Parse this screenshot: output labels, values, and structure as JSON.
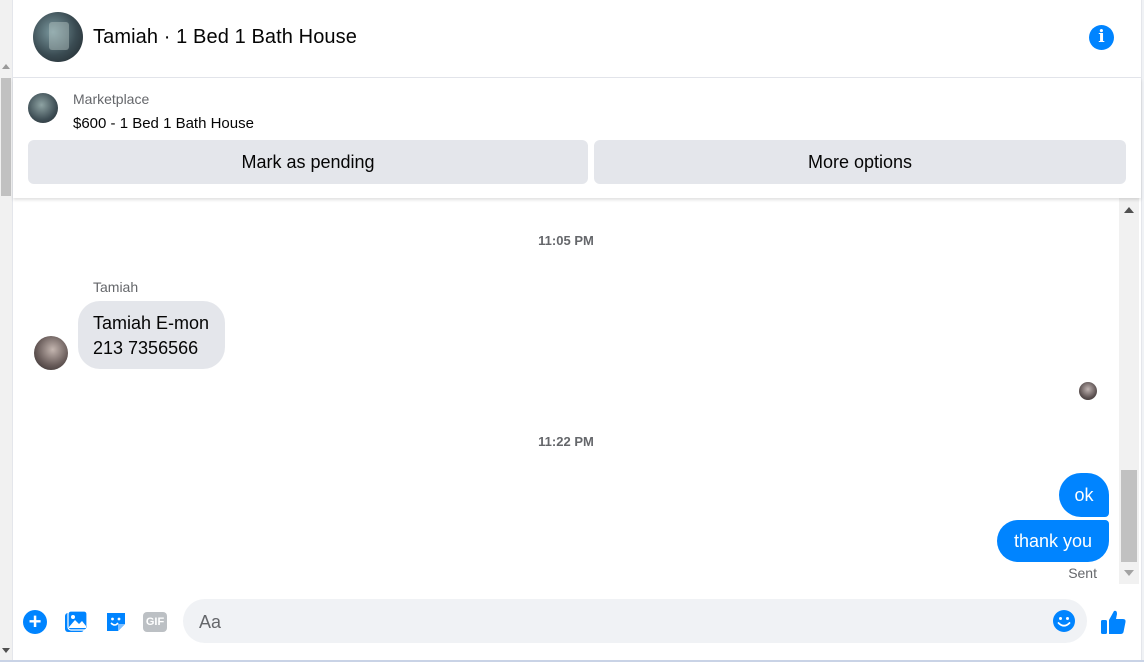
{
  "header": {
    "title": "Tamiah · 1 Bed 1 Bath House",
    "info_icon": "info-icon"
  },
  "listing": {
    "label": "Marketplace",
    "price_title": "$600 - 1 Bed 1 Bath House",
    "buttons": [
      {
        "label": "Mark as pending"
      },
      {
        "label": "More options"
      }
    ]
  },
  "conversation": {
    "timestamps": [
      "11:05 PM",
      "11:22 PM"
    ],
    "incoming": {
      "sender": "Tamiah",
      "lines": [
        "Tamiah E-mon",
        "213 7356566"
      ]
    },
    "outgoing": [
      {
        "text": "ok"
      },
      {
        "text": "thank you"
      }
    ],
    "status": "Sent"
  },
  "composer": {
    "placeholder": "Aa",
    "icons": [
      "plus-icon",
      "photo-icon",
      "sticker-icon",
      "gif-icon",
      "emoji-icon",
      "thumbs-up-icon"
    ],
    "gif_label": "GIF"
  },
  "colors": {
    "accent": "#0084ff",
    "bubble_in": "#e4e6eb",
    "button_bg": "#e4e6eb"
  }
}
